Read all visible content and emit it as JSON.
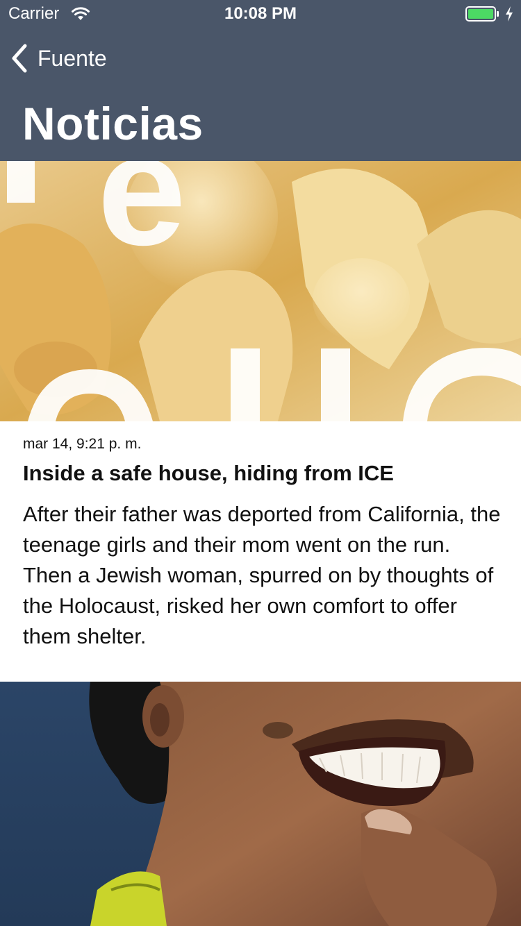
{
  "status_bar": {
    "carrier": "Carrier",
    "time": "10:08 PM"
  },
  "nav": {
    "back_label": "Fuente",
    "title": "Noticias"
  },
  "articles": [
    {
      "date": "mar 14, 9:21 p. m.",
      "headline": "Inside a safe house, hiding from ICE",
      "summary": "After their father was deported from California, the teenage girls and their mom went on the run. Then a Jewish woman, spurred on by thoughts of the Holocaust, risked her own comfort to offer them shelter."
    }
  ],
  "colors": {
    "nav_background": "#4a5669",
    "battery_fill": "#4cd964",
    "card_background": "#ffffff"
  },
  "icons": [
    "wifi-icon",
    "battery-icon",
    "charging-bolt-icon",
    "chevron-left-icon"
  ]
}
